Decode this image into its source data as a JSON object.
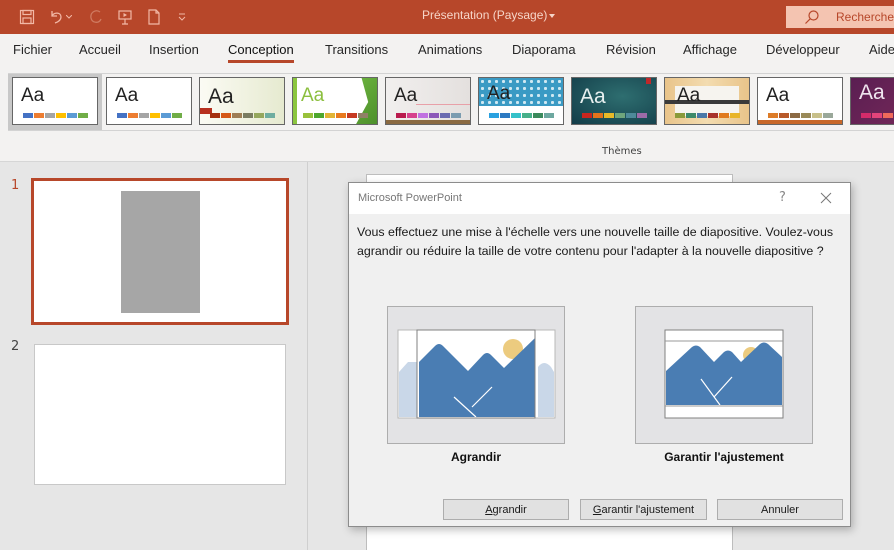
{
  "titlebar": {
    "document_title": "Présentation (Paysage)",
    "search_placeholder": "Rechercher",
    "brand_color": "#b7472a",
    "qat": [
      "save-icon",
      "undo-icon",
      "undo-dropdown-icon",
      "redo-icon",
      "present-from-start-icon",
      "new-document-icon",
      "customize-qat-icon"
    ]
  },
  "tabs": [
    {
      "label": "Fichier",
      "active": false
    },
    {
      "label": "Accueil",
      "active": false
    },
    {
      "label": "Insertion",
      "active": false
    },
    {
      "label": "Conception",
      "active": true
    },
    {
      "label": "Transitions",
      "active": false
    },
    {
      "label": "Animations",
      "active": false
    },
    {
      "label": "Diaporama",
      "active": false
    },
    {
      "label": "Révision",
      "active": false
    },
    {
      "label": "Affichage",
      "active": false
    },
    {
      "label": "Développeur",
      "active": false
    },
    {
      "label": "Aide",
      "active": false
    }
  ],
  "ribbon": {
    "group_label": "Thèmes",
    "themes": [
      {
        "sample": "Aa",
        "selected": true,
        "colors": [
          "#4472c4",
          "#ed7d31",
          "#a5a5a5",
          "#ffc000",
          "#5b9bd5",
          "#70ad47"
        ]
      },
      {
        "sample": "Aa",
        "selected": false,
        "colors": [
          "#4472c4",
          "#ed7d31",
          "#a5a5a5",
          "#ffc000",
          "#5b9bd5",
          "#70ad47"
        ]
      },
      {
        "sample": "Aa",
        "selected": false,
        "colors": [
          "#a5300f",
          "#d55816",
          "#9f7e55",
          "#7a7c62",
          "#95a75d",
          "#6fada0"
        ]
      },
      {
        "sample": "Aa",
        "selected": false,
        "colors": [
          "#99c13b",
          "#4ea72e",
          "#e2b436",
          "#e97a1e",
          "#c63a22",
          "#908166"
        ]
      },
      {
        "sample": "Aa",
        "selected": false,
        "colors": [
          "#b91a4d",
          "#d6418c",
          "#c070e0",
          "#8c58b8",
          "#6a6ab0",
          "#7b9cb0"
        ]
      },
      {
        "sample": "Aa",
        "selected": false,
        "colors": [
          "#2aa1e0",
          "#2d7ac2",
          "#35c1c9",
          "#47b08a",
          "#3b8a5c",
          "#6da8a0"
        ]
      },
      {
        "sample": "Aa",
        "selected": false,
        "colors": [
          "#c8261f",
          "#e3731b",
          "#e8b928",
          "#6fa57c",
          "#4e8a9a",
          "#9c6ba8"
        ]
      },
      {
        "sample": "Aa",
        "selected": false,
        "colors": [
          "#8a9a3a",
          "#3e8a6a",
          "#4a78a8",
          "#a8322a",
          "#e07a1e",
          "#e8b428"
        ]
      },
      {
        "sample": "Aa",
        "selected": false,
        "colors": [
          "#dd7c28",
          "#b85a2a",
          "#8c6a44",
          "#9a8a58",
          "#c8c08a",
          "#9aa89a"
        ]
      },
      {
        "sample": "Aa",
        "selected": false,
        "colors": [
          "#d42b6a",
          "#e2447a",
          "#ef6a5a",
          "#f0a040",
          "#e8c050",
          "#b060a0"
        ]
      }
    ]
  },
  "slides": [
    {
      "number": "1",
      "selected": true
    },
    {
      "number": "2",
      "selected": false
    }
  ],
  "dialog": {
    "title": "Microsoft PowerPoint",
    "help": "?",
    "message": "Vous effectuez une mise à l'échelle vers une nouvelle taille de diapositive. Voulez-vous agrandir ou réduire la taille de votre contenu pour l'adapter à la nouvelle diapositive ?",
    "options": [
      {
        "label": "Agrandir"
      },
      {
        "label": "Garantir l'ajustement"
      }
    ],
    "buttons": {
      "maximize": {
        "accel": "A",
        "rest": "grandir"
      },
      "ensure_fit": {
        "accel": "G",
        "rest": "arantir l'ajustement"
      },
      "cancel": "Annuler"
    }
  }
}
